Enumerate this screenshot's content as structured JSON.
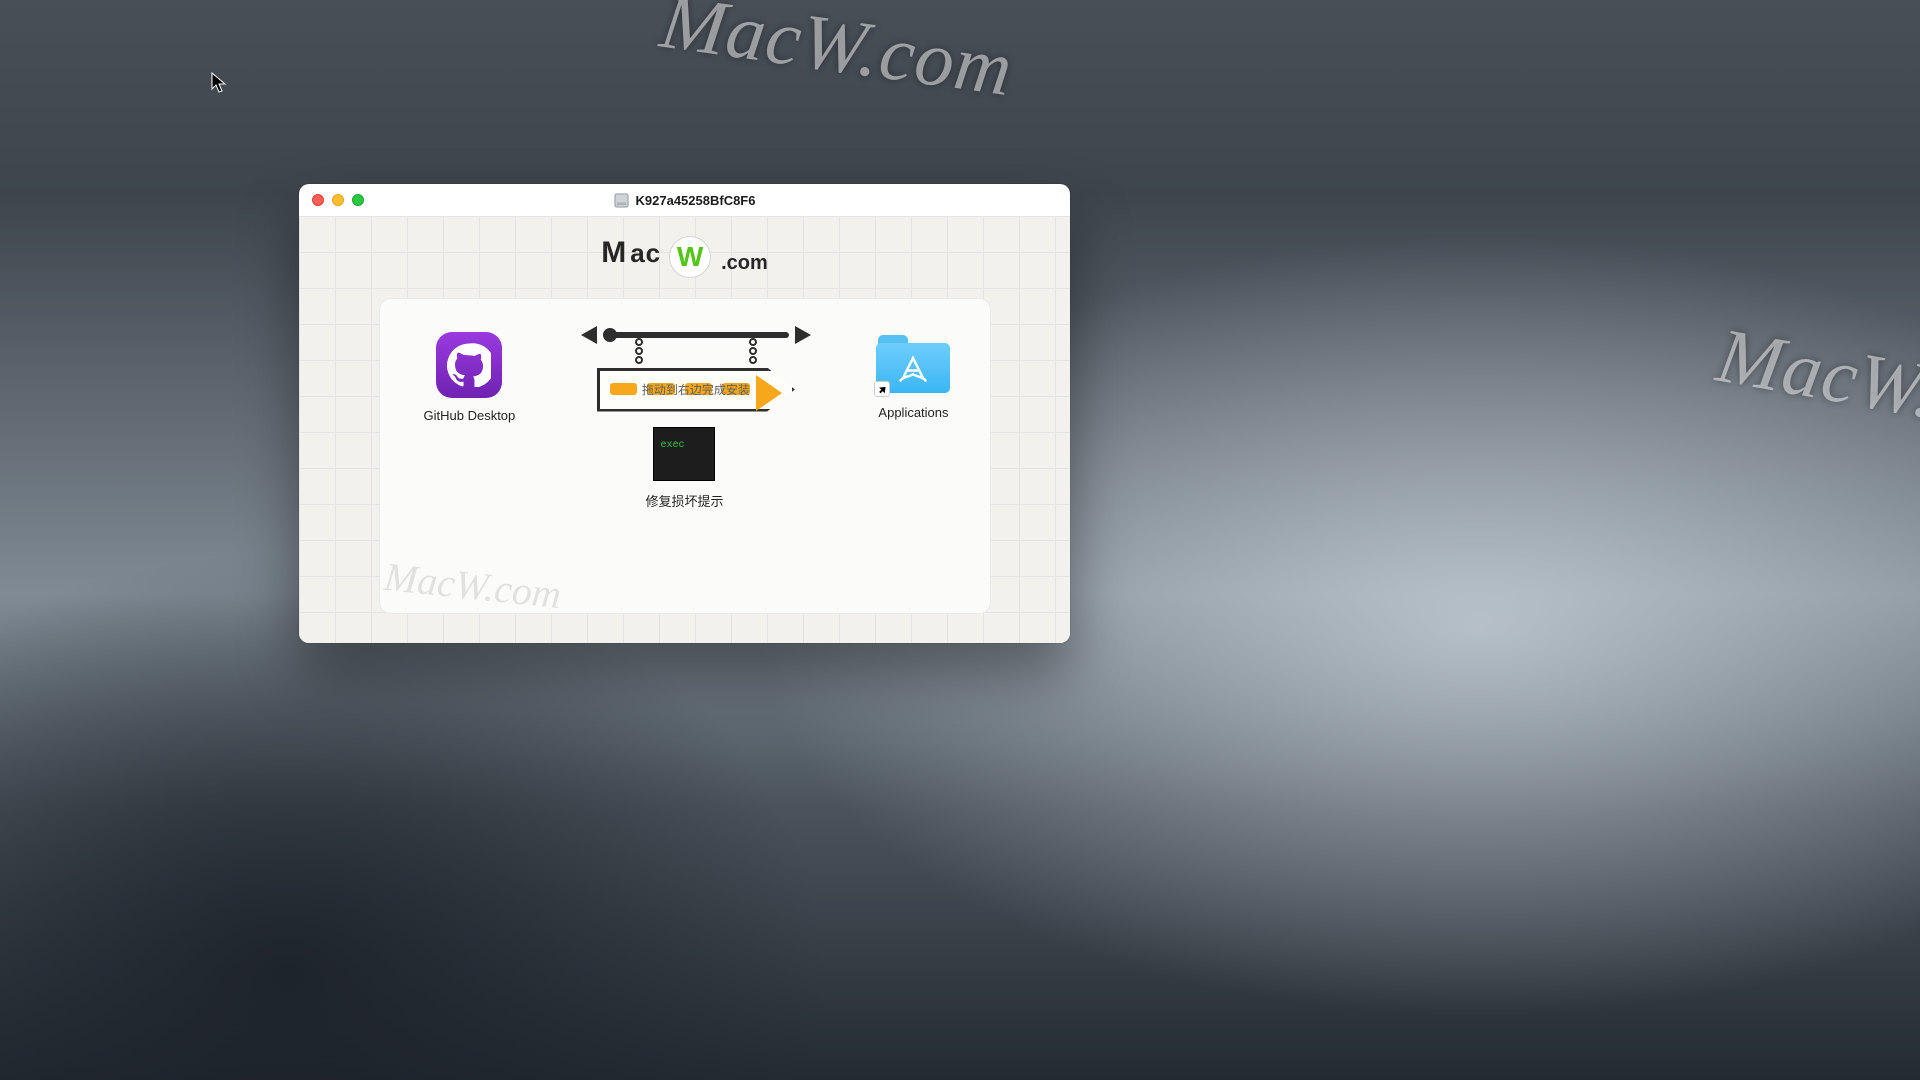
{
  "watermark": "MacW.com",
  "window": {
    "title": "K927a45258BfC8F6",
    "brand_main": "Mac",
    "brand_w": "W",
    "brand_suffix": ".com"
  },
  "items": {
    "app": "GitHub Desktop",
    "applications": "Applications",
    "sign_text": "拖动到右边完成安装",
    "exec_label": "exec",
    "exec_name": "修复损坏提示"
  }
}
